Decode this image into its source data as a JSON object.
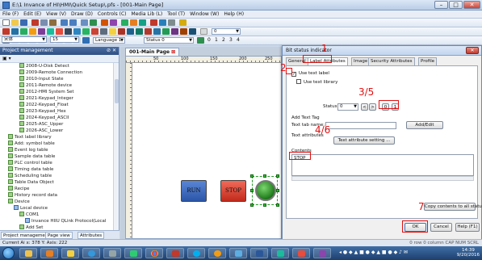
{
  "window": {
    "title": "E:\\1 Invance of HI\\HMI\\Quick Setup\\.pfs - [001-Main Page]",
    "minimize": "–",
    "maximize": "□",
    "close": "✕"
  },
  "menu": [
    "File (F)",
    "Edit (E)",
    "View (V)",
    "Draw (D)",
    "Controls (C)",
    "Media Lib (L)",
    "Tool (T)",
    "Window (W)",
    "Help (H)"
  ],
  "toolbar3": {
    "language_label": "Language 1",
    "status_label": "Status 0",
    "numbers": [
      "0",
      "1",
      "2",
      "3",
      "4"
    ],
    "font_combo": "宋体",
    "size_combo": "15"
  },
  "left_panel": {
    "header": "Project management",
    "pin": "⊘ ✕",
    "tree": [
      {
        "label": "2008-U-Disk Detect",
        "indent": 3
      },
      {
        "label": "2009-Remote Connection",
        "indent": 3
      },
      {
        "label": "2010-Input State",
        "indent": 3
      },
      {
        "label": "2011-Remote device",
        "indent": 3
      },
      {
        "label": "2012-HMI System Set",
        "indent": 3
      },
      {
        "label": "2021-Keypad_Integer",
        "indent": 3
      },
      {
        "label": "2022-Keypad_Float",
        "indent": 3
      },
      {
        "label": "2023-Keypad_Hex",
        "indent": 3
      },
      {
        "label": "2024-Keypad_ASCII",
        "indent": 3
      },
      {
        "label": "2025-ASC_Upper",
        "indent": 3
      },
      {
        "label": "2026-ASC_Lower",
        "indent": 3
      },
      {
        "label": "Text label library",
        "indent": 1
      },
      {
        "label": "Add: symbol table",
        "indent": 1
      },
      {
        "label": "Event log table",
        "indent": 1
      },
      {
        "label": "Sample data table",
        "indent": 1
      },
      {
        "label": "PLC control table",
        "indent": 1
      },
      {
        "label": "Timing data table",
        "indent": 1
      },
      {
        "label": "Scheduling table",
        "indent": 1
      },
      {
        "label": "Table Data Object",
        "indent": 1
      },
      {
        "label": "Recipe",
        "indent": 1
      },
      {
        "label": "History record data",
        "indent": 1
      },
      {
        "label": "Device",
        "indent": 1
      },
      {
        "label": "Local device",
        "indent": 2
      },
      {
        "label": "COM1",
        "indent": 3
      },
      {
        "label": "Invance HIIU QLink Protocol(Local",
        "indent": 4
      },
      {
        "label": "Add Set",
        "indent": 3
      }
    ],
    "tabs": [
      "Project management",
      "Page view",
      "Attributes"
    ]
  },
  "editor": {
    "tab": "001-Main Page",
    "tab_close": "⊠",
    "ruler_labels": [
      "50",
      "100",
      "150",
      "200",
      "250",
      "300"
    ],
    "run_label": "RUN",
    "stop_label": "STOP"
  },
  "dialog": {
    "title": "Bit status indicator",
    "close": "✕",
    "tabs": [
      "General",
      "Label Attributes",
      "Image",
      "Security Attributes",
      "Profile"
    ],
    "active_tab": "Label Attributes",
    "use_text_label": "Use text label",
    "use_text_library": "Use text library",
    "status_label": "Status:",
    "status_value": "0",
    "status_arrows": [
      "<",
      ">"
    ],
    "btn_0": "0",
    "btn_1": "1",
    "add_text_tag": "Add Text Tag",
    "text_tab_name": "Text tab name:",
    "add_edit": "Add/Edit",
    "text_attributes": "Text attributes",
    "text_attr_setting": "Text attribute setting ...",
    "contents_label": "Contents",
    "contents_value": "STOP",
    "copy_all": "Copy contents to all status",
    "ok": "OK",
    "cancel": "Cancel",
    "help": "Help (F1)"
  },
  "annotations": {
    "a1": "1",
    "a2": "2",
    "a35": "3/5",
    "a46": "4/6",
    "a7": "7",
    "color": "#e31010"
  },
  "statusbar": {
    "left": "Current Ai x: 378  Y: Axis: 222",
    "right": "0 row 0 column CAP NUM SCRL"
  },
  "taskbar": {
    "time": "14:39",
    "date": "9/20/2016"
  }
}
